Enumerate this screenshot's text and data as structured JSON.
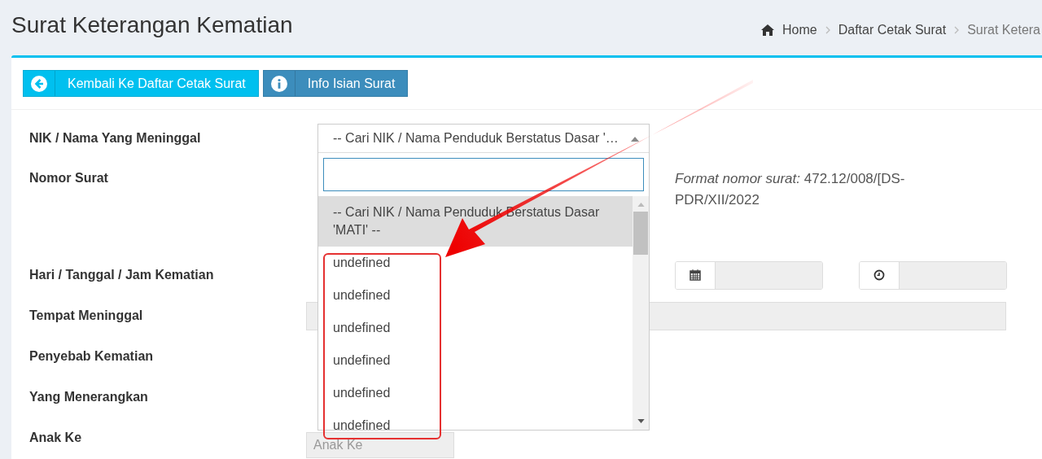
{
  "header": {
    "title": "Surat Keterangan Kematian",
    "breadcrumb": [
      {
        "label": "Home",
        "kind": "home"
      },
      {
        "label": "Daftar Cetak Surat",
        "kind": "link"
      },
      {
        "label": "Surat Ketera",
        "kind": "current"
      }
    ]
  },
  "buttons": [
    {
      "label": "Kembali Ke Daftar Cetak Surat",
      "kind": "back"
    },
    {
      "label": "Info Isian Surat",
      "kind": "info"
    }
  ],
  "form": {
    "fields": [
      {
        "label": "NIK / Nama Yang Meninggal",
        "kind": "select"
      },
      {
        "label": "Nomor Surat",
        "kind": "note",
        "note": "*Format nomor surat:* 472.12/008/[DS-PDR/XII/2022"
      },
      {
        "label": "Hari / Tanggal / Jam Kematian",
        "kind": "datetime"
      },
      {
        "label": "Tempat Meninggal",
        "kind": "wide"
      },
      {
        "label": "Penyebab Kematian",
        "kind": "hidden"
      },
      {
        "label": "Yang Menerangkan",
        "kind": "hidden"
      },
      {
        "label": "Anak Ke",
        "kind": "short",
        "placeholder": "Anak Ke"
      }
    ]
  },
  "dropdown": {
    "selected_text": "-- Cari NIK / Nama Penduduk Berstatus Dasar '…",
    "options": [
      {
        "label": "-- Cari NIK / Nama Penduduk Berstatus Dasar 'MATI' --",
        "selected": true
      },
      {
        "label": "undefined",
        "selected": false
      },
      {
        "label": "undefined",
        "selected": false
      },
      {
        "label": "undefined",
        "selected": false
      },
      {
        "label": "undefined",
        "selected": false
      },
      {
        "label": "undefined",
        "selected": false
      },
      {
        "label": "undefined",
        "selected": false
      }
    ]
  }
}
